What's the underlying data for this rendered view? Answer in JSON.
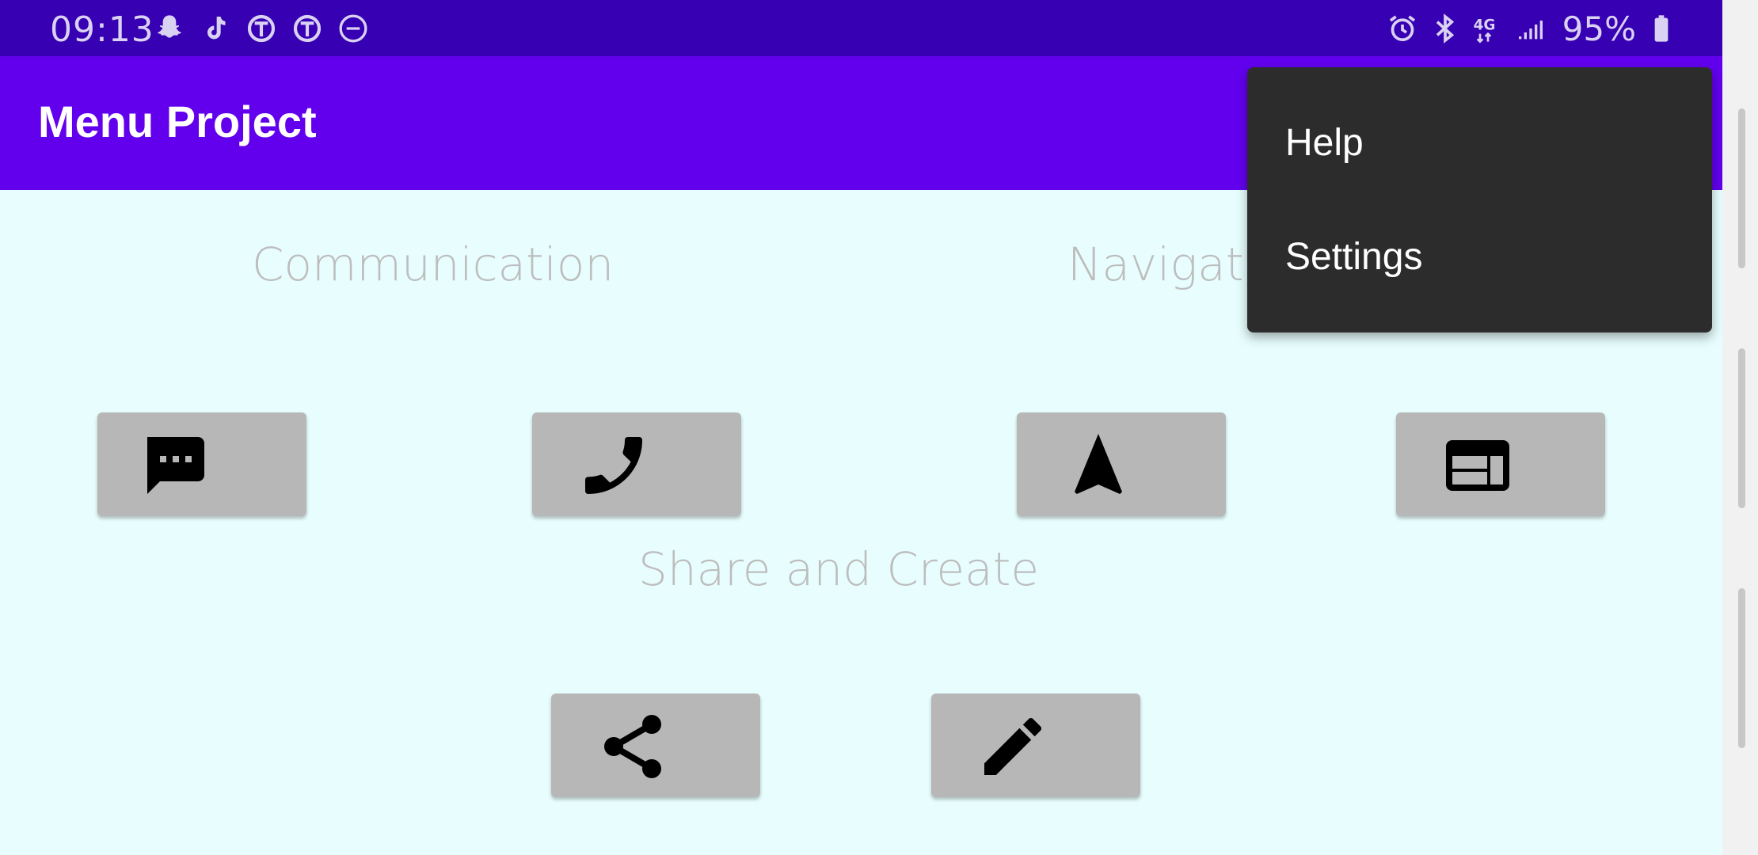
{
  "status_bar": {
    "time": "09:13",
    "left_icons": [
      "snapchat-icon",
      "tiktok-icon",
      "nytimes-icon",
      "nytimes-icon",
      "do-not-disturb-icon"
    ],
    "right_icons": [
      "alarm-icon",
      "bluetooth-icon",
      "4g-lte-icon",
      "signal-icon"
    ],
    "battery_percent": "95%"
  },
  "app_bar": {
    "title": "Menu Project"
  },
  "sections": {
    "communication": "Communication",
    "navigation": "Navigation",
    "share_create": "Share and Create"
  },
  "buttons": [
    {
      "name": "message-button",
      "icon": "message-icon"
    },
    {
      "name": "phone-button",
      "icon": "phone-icon"
    },
    {
      "name": "navigation-button",
      "icon": "navigation-arrow-icon"
    },
    {
      "name": "web-button",
      "icon": "web-layout-icon"
    },
    {
      "name": "share-button",
      "icon": "share-icon"
    },
    {
      "name": "edit-button",
      "icon": "pencil-icon"
    }
  ],
  "overflow_menu": {
    "items": [
      {
        "label": "Help"
      },
      {
        "label": "Settings"
      }
    ]
  },
  "colors": {
    "status_bar": "#3800b3",
    "app_bar": "#6200ee",
    "background": "#e8fefe",
    "button": "#b7b7b7",
    "menu": "#2c2c2c"
  }
}
